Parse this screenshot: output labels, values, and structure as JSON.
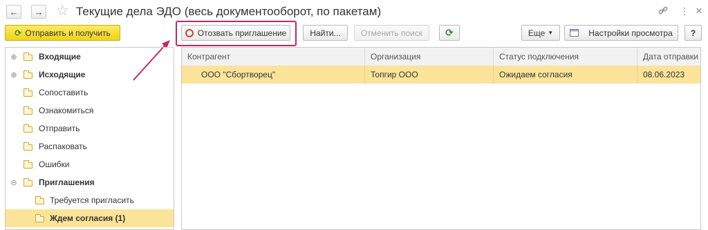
{
  "window": {
    "title": "Текущие дела ЭДО (весь документооборот, по пакетам)",
    "back_glyph": "←",
    "forward_glyph": "→",
    "star_glyph": "☆",
    "link_glyph": "🔗",
    "more_glyph": "⋮",
    "close_glyph": "×"
  },
  "toolbar": {
    "send_receive": "Отправить и получить",
    "revoke_invitation": "Отозвать приглашение",
    "find": "Найти...",
    "cancel_search": "Отменить поиск",
    "refresh_glyph": "⟳",
    "more": "Еще",
    "view_settings": "Настройки просмотра",
    "help": "?"
  },
  "tree": {
    "items": [
      {
        "label": "Входящие",
        "bold": true
      },
      {
        "label": "Исходящие",
        "bold": true
      },
      {
        "label": "Сопоставить"
      },
      {
        "label": "Ознакомиться"
      },
      {
        "label": "Отправить"
      },
      {
        "label": "Распаковать"
      },
      {
        "label": "Ошибки"
      },
      {
        "label": "Приглашения",
        "bold": true
      },
      {
        "label": "Требуется пригласить"
      },
      {
        "label": "Ждем согласия (1)",
        "bold": true,
        "selected": true
      }
    ]
  },
  "table": {
    "columns": [
      "Контрагент",
      "Организация",
      "Статус подключения",
      "Дата отправки"
    ],
    "rows": [
      [
        "ООО \"Сбортворец\"",
        "Топгир ООО",
        "Ожидаем согласия",
        "08.06.2023"
      ]
    ]
  },
  "colors": {
    "accent_highlight": "#c72566",
    "selection": "#fbe399",
    "primary_button": "#f1d318"
  }
}
